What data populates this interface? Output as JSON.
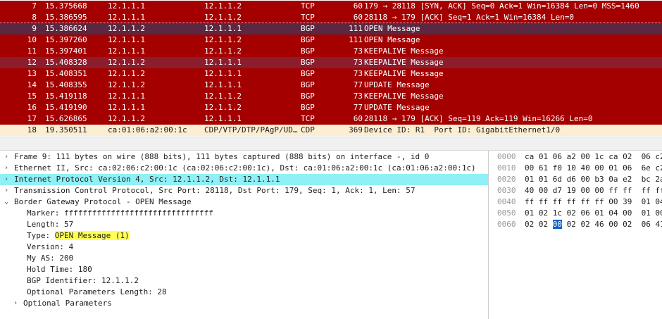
{
  "packet_list": {
    "rows": [
      {
        "no": "7",
        "time": "15.375668",
        "src": "12.1.1.1",
        "dst": "12.1.1.2",
        "proto": "TCP",
        "len": "60",
        "info": "179 → 28118 [SYN, ACK] Seq=0 Ack=1 Win=16384 Len=0 MSS=1460",
        "bg": "#a40000",
        "fg": "#ffffff"
      },
      {
        "no": "8",
        "time": "15.386595",
        "src": "12.1.1.1",
        "dst": "12.1.1.2",
        "proto": "TCP",
        "len": "60",
        "info": "28118 → 179 [ACK] Seq=1 Ack=1 Win=16384 Len=0",
        "bg": "#a40000",
        "fg": "#ffffff"
      },
      {
        "no": "9",
        "time": "15.386624",
        "src": "12.1.1.2",
        "dst": "12.1.1.1",
        "proto": "BGP",
        "len": "111",
        "info": "OPEN Message",
        "bg": "#5c2740",
        "fg": "#ffffff",
        "selected": true
      },
      {
        "no": "10",
        "time": "15.397260",
        "src": "12.1.1.1",
        "dst": "12.1.1.2",
        "proto": "BGP",
        "len": "111",
        "info": "OPEN Message",
        "bg": "#a40000",
        "fg": "#ffffff"
      },
      {
        "no": "11",
        "time": "15.397401",
        "src": "12.1.1.1",
        "dst": "12.1.1.2",
        "proto": "BGP",
        "len": "73",
        "info": "KEEPALIVE Message",
        "bg": "#a40000",
        "fg": "#ffffff"
      },
      {
        "no": "12",
        "time": "15.408328",
        "src": "12.1.1.2",
        "dst": "12.1.1.1",
        "proto": "BGP",
        "len": "73",
        "info": "KEEPALIVE Message",
        "bg": "#8b1d2c",
        "fg": "#ffffff"
      },
      {
        "no": "13",
        "time": "15.408351",
        "src": "12.1.1.2",
        "dst": "12.1.1.1",
        "proto": "BGP",
        "len": "73",
        "info": "KEEPALIVE Message",
        "bg": "#a40000",
        "fg": "#ffffff"
      },
      {
        "no": "14",
        "time": "15.408355",
        "src": "12.1.1.2",
        "dst": "12.1.1.1",
        "proto": "BGP",
        "len": "77",
        "info": "UPDATE Message",
        "bg": "#a40000",
        "fg": "#ffffff"
      },
      {
        "no": "15",
        "time": "15.419118",
        "src": "12.1.1.1",
        "dst": "12.1.1.2",
        "proto": "BGP",
        "len": "73",
        "info": "KEEPALIVE Message",
        "bg": "#a40000",
        "fg": "#ffffff"
      },
      {
        "no": "16",
        "time": "15.419190",
        "src": "12.1.1.1",
        "dst": "12.1.1.2",
        "proto": "BGP",
        "len": "77",
        "info": "UPDATE Message",
        "bg": "#a40000",
        "fg": "#ffffff"
      },
      {
        "no": "17",
        "time": "15.626865",
        "src": "12.1.1.2",
        "dst": "12.1.1.1",
        "proto": "TCP",
        "len": "60",
        "info": "28118 → 179 [ACK] Seq=119 Ack=119 Win=16266 Len=0",
        "bg": "#a40000",
        "fg": "#ffffff"
      },
      {
        "no": "18",
        "time": "19.350511",
        "src": "ca:01:06:a2:00:1c",
        "dst": "CDP/VTP/DTP/PAgP/UD…",
        "proto": "CDP",
        "len": "369",
        "info": "Device ID: R1  Port ID: GigabitEthernet1/0",
        "bg": "#fbeed2",
        "fg": "#1a1a1a"
      }
    ]
  },
  "details": {
    "rows": [
      {
        "indent": 0,
        "twisty": "›",
        "text": "Frame 9: 111 bytes on wire (888 bits), 111 bytes captured (888 bits) on interface -, id 0"
      },
      {
        "indent": 0,
        "twisty": "›",
        "text": "Ethernet II, Src: ca:02:06:c2:00:1c (ca:02:06:c2:00:1c), Dst: ca:01:06:a2:00:1c (ca:01:06:a2:00:1c)"
      },
      {
        "indent": 0,
        "twisty": "›",
        "text": "Internet Protocol Version 4, Src: 12.1.1.2, Dst: 12.1.1.1",
        "bg": "#8ff0f7"
      },
      {
        "indent": 0,
        "twisty": "›",
        "text": "Transmission Control Protocol, Src Port: 28118, Dst Port: 179, Seq: 1, Ack: 1, Len: 57"
      },
      {
        "indent": 0,
        "twisty": "⌄",
        "text": "Border Gateway Protocol - OPEN Message"
      },
      {
        "indent": 2,
        "twisty": "",
        "text": "Marker: ffffffffffffffffffffffffffffffff"
      },
      {
        "indent": 2,
        "twisty": "",
        "text": "Length: 57"
      },
      {
        "indent": 2,
        "twisty": "",
        "text": "Type: ",
        "highlight": "OPEN Message (1)"
      },
      {
        "indent": 2,
        "twisty": "",
        "text": "Version: 4"
      },
      {
        "indent": 2,
        "twisty": "",
        "text": "My AS: 200"
      },
      {
        "indent": 2,
        "twisty": "",
        "text": "Hold Time: 180"
      },
      {
        "indent": 2,
        "twisty": "",
        "text": "BGP Identifier: 12.1.1.2"
      },
      {
        "indent": 2,
        "twisty": "",
        "text": "Optional Parameters Length: 28"
      },
      {
        "indent": 1,
        "twisty": "›",
        "text": "Optional Parameters"
      }
    ]
  },
  "hex": {
    "rows": [
      {
        "offset": "0000",
        "bytes": "ca 01 06 a2 00 1c ca 02  06 c2"
      },
      {
        "offset": "0010",
        "bytes": "00 61 f0 10 40 00 01 06  6e c2"
      },
      {
        "offset": "0020",
        "bytes": "01 01 6d d6 00 b3 0a e2  bc 2a"
      },
      {
        "offset": "0030",
        "bytes": "40 00 d7 19 00 00 ff ff  ff ff"
      },
      {
        "offset": "0040",
        "bytes": "ff ff ff ff ff ff 00 39  01 04"
      },
      {
        "offset": "0050",
        "bytes": "01 02 1c 02 06 01 04 00  01 00"
      },
      {
        "offset": "0060",
        "pre": "02 02 ",
        "sel": "00",
        "post": " 02 02 46 00 02  06 41"
      }
    ]
  },
  "colors": {
    "bad_tcp_row": "#a40000",
    "selected_row": "#5c2740",
    "cdp_row": "#fbeed2",
    "ipv4_highlight": "#8ff0f7",
    "field_highlight": "#ffff54",
    "hex_selection": "#0c62c6"
  }
}
